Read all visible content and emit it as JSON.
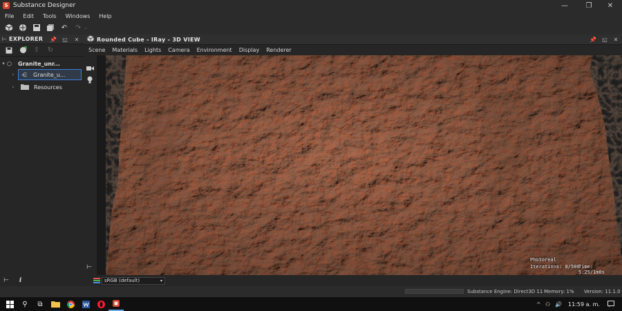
{
  "app": {
    "title": "Substance Designer",
    "logo_letter": "S",
    "accent": "#d2452c"
  },
  "window": {
    "minimize": "—",
    "restore": "❐",
    "close": "✕"
  },
  "menu": [
    "File",
    "Edit",
    "Tools",
    "Windows",
    "Help"
  ],
  "toolbar": {
    "icons": [
      "new-graph-icon",
      "open-package-icon",
      "save-icon",
      "save-all-icon",
      "undo-icon",
      "redo-icon"
    ]
  },
  "explorer": {
    "title": "EXPLORER",
    "package": "Granite_unr...",
    "graph": "Granite_u...",
    "resources": "Resources"
  },
  "viewport": {
    "title": "Rounded Cube - IRay - 3D VIEW",
    "menu": [
      "Scene",
      "Materials",
      "Lights",
      "Camera",
      "Environment",
      "Display",
      "Renderer"
    ],
    "status": {
      "mode": "Photoreal",
      "iterations": "Iterations: 8/500",
      "time": "Time: 5:25/1m0s"
    },
    "colorspace": "sRGB (default)"
  },
  "statusbar": {
    "engine": "Substance Engine: Direct3D 11",
    "memory": "Memory: 1%",
    "version": "Version: 11.1.0"
  },
  "taskbar": {
    "time": "11:59 a. m.",
    "tray": [
      "^",
      "⚇",
      "🔊"
    ]
  }
}
